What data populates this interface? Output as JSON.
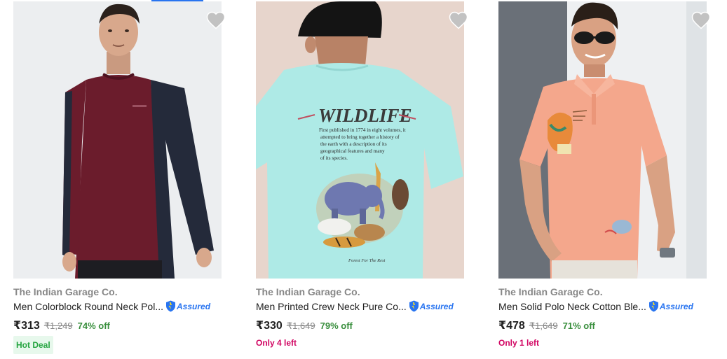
{
  "accent_color": "#2874f0",
  "products": [
    {
      "brand": "The Indian Garage Co.",
      "title": "Men Colorblock Round Neck Pol...",
      "assured_label": "Assured",
      "price": "₹313",
      "mrp": "₹1,249",
      "discount": "74% off",
      "tag": "Hot Deal",
      "image_alt": "Maroon and navy colorblock full sleeve t-shirt worn by model",
      "wishlist_icon": "heart-icon"
    },
    {
      "brand": "The Indian Garage Co.",
      "title": "Men Printed Crew Neck Pure Co...",
      "assured_label": "Assured",
      "price": "₹330",
      "mrp": "₹1,649",
      "discount": "79% off",
      "tag": "Only 4 left",
      "image_alt": "Aqua t-shirt with Wildlife animal print on the back",
      "wishlist_icon": "heart-icon",
      "print": {
        "heading": "WILDLIFE",
        "lines": [
          "First published in 1774 in eight volumes, it",
          "attempted to bring together a history of",
          "the earth with a description of its",
          "geographical features and many",
          "of its species."
        ],
        "footer": "Forest For The Rest"
      }
    },
    {
      "brand": "The Indian Garage Co.",
      "title": "Men Solid Polo Neck Cotton Ble...",
      "assured_label": "Assured",
      "price": "₹478",
      "mrp": "₹1,649",
      "discount": "71% off",
      "tag": "Only 1 left",
      "image_alt": "Peach polo t-shirt with tropical print worn by model",
      "wishlist_icon": "heart-icon"
    }
  ]
}
